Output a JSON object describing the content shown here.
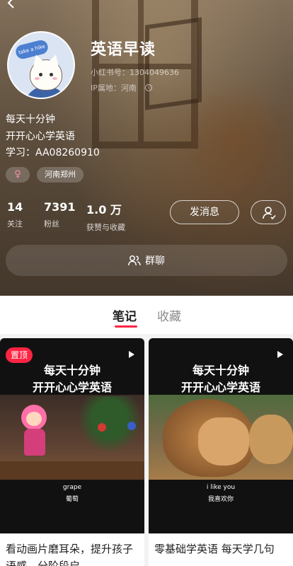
{
  "profile": {
    "name": "英语早读",
    "xhs_id": "小红书号：1304049636",
    "ip_location": "IP属地：河南",
    "avatar_bubble": "take a hike",
    "bio": [
      "每天十分钟",
      "开开心心学英语",
      "学习：AA08260910"
    ],
    "gender_symbol": "♀",
    "location_tag": "河南郑州"
  },
  "stats": [
    {
      "value": "14",
      "label": "关注"
    },
    {
      "value": "7391",
      "label": "粉丝"
    },
    {
      "value": "1.0 万",
      "label": "获赞与收藏"
    }
  ],
  "actions": {
    "message_label": "发消息",
    "group_chat_label": "群聊"
  },
  "tabs": [
    {
      "label": "笔记",
      "active": true
    },
    {
      "label": "收藏",
      "active": false
    }
  ],
  "notes": [
    {
      "pinned_label": "置顶",
      "cover_title_1": "每天十分钟",
      "cover_title_2": "开开心心学英语",
      "subtitle_en": "grape",
      "subtitle_cn": "葡萄",
      "caption": "看动画片磨耳朵，提升孩子语感，分阶段启..."
    },
    {
      "cover_title_1": "每天十分钟",
      "cover_title_2": "开开心心学英语",
      "subtitle_en": "i like you",
      "subtitle_cn": "我喜欢你",
      "caption": "零基础学英语 每天学几句"
    }
  ],
  "colors": {
    "accent": "#ff2442",
    "header_bg": "#6d5b47"
  }
}
